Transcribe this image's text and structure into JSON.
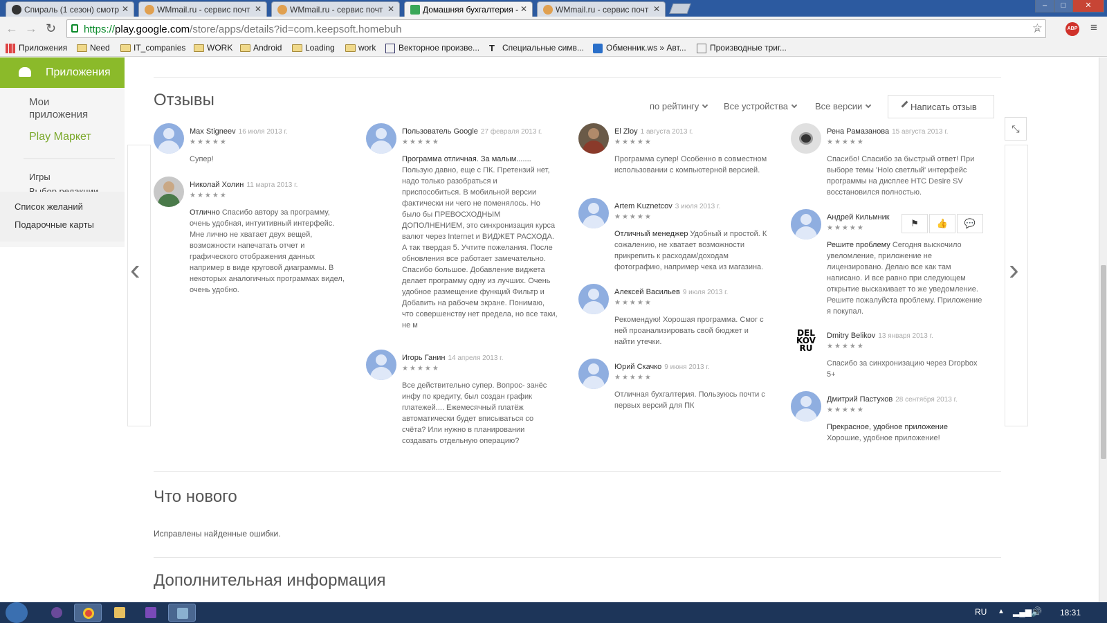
{
  "tabs": [
    {
      "label": "Спираль (1 сезон) смотр"
    },
    {
      "label": "WMmail.ru - сервис почт"
    },
    {
      "label": "WMmail.ru - сервис почт"
    },
    {
      "label": "Домашняя бухгалтерия -"
    },
    {
      "label": "WMmail.ru - сервис почт"
    }
  ],
  "window_controls": {
    "minimize": "–",
    "maximize": "□",
    "close": "✕"
  },
  "nav": {
    "back": "←",
    "forward": "→",
    "reload": "↻"
  },
  "url": {
    "scheme": "https://",
    "domain": "play.google.com",
    "path": "/store/apps/details?id=com.keepsoft.homebuh"
  },
  "abp": "ABP",
  "bookmarks": [
    {
      "label": "Приложения",
      "type": "apps"
    },
    {
      "label": "Need",
      "type": "folder"
    },
    {
      "label": "IT_companies",
      "type": "folder"
    },
    {
      "label": "WORK",
      "type": "folder"
    },
    {
      "label": "Android",
      "type": "folder"
    },
    {
      "label": "Loading",
      "type": "folder"
    },
    {
      "label": "work",
      "type": "folder"
    },
    {
      "label": "Векторное произве...",
      "type": "site"
    },
    {
      "label": "Специальные симв...",
      "type": "site"
    },
    {
      "label": "Обменник.ws » Авт...",
      "type": "site"
    },
    {
      "label": "Производные триг...",
      "type": "site"
    }
  ],
  "sidebar": {
    "header": "Приложения",
    "my_apps": "Мои приложения",
    "play_market": "Play Маркет",
    "games": "Игры",
    "editors_choice": "Выбор редакции",
    "wishlist": "Список желаний",
    "gift_cards": "Подарочные карты"
  },
  "reviews_section": {
    "title": "Отзывы",
    "filter_rating": "по рейтингу",
    "filter_devices": "Все устройства",
    "filter_versions": "Все версии",
    "write_review": "Написать отзыв",
    "prev": "‹",
    "next": "›",
    "collapse": "⤡"
  },
  "reviews": [
    {
      "name": "Max Stigneev",
      "date": "16 июля 2013 г.",
      "stars": "★★★★★",
      "title": "",
      "text": "Супер!"
    },
    {
      "name": "Николай Холин",
      "date": "11 марта 2013 г.",
      "stars": "★★★★★",
      "title": "Отлично",
      "text": "Спасибо автору за программу, очень удобная, интуитивный интерфейс. Мне лично не хватает двух вещей, возможности напечатать отчет и графического отображения данных например в виде круговой диаграммы. В некоторых аналогичных программах видел, очень удобно."
    },
    {
      "name": "Пользователь Google",
      "date": "27 февраля 2013 г.",
      "stars": "★★★★★",
      "title": "Программа отличная. За малым.......",
      "text": "Пользую давно, еще с ПК. Претензий нет, надо только разобраться и приспособиться. В мобильной версии фактически ни чего не поменялось. Но было бы ПРЕВОСХОДНЫМ ДОПОЛНЕНИЕМ, это синхронизация курса валют через Internet и ВИДЖЕТ РАСХОДА. А так твердая 5. Учтите пожелания. После обновления все работает замечательно. Спасибо большое. Добавление виджета делает программу одну из лучших. Очень удобное размещение функций Фильтр и Добавить на рабочем экране. Понимаю, что совершенству нет предела, но все таки, не м"
    },
    {
      "name": "Игорь Ганин",
      "date": "14 апреля 2013 г.",
      "stars": "★★★★★",
      "title": "",
      "text": "Все действительно супер. Вопрос- занёс инфу по кредиту, был создан график платежей.... Ежемесячный платёж автоматически будет вписываться со счёта? Или нужно в планировании создавать отдельную операцию?"
    },
    {
      "name": "El Zloy",
      "date": "1 августа 2013 г.",
      "stars": "★★★★★",
      "title": "",
      "text": "Программа супер! Особенно в совместном использовании с компьютерной версией."
    },
    {
      "name": "Artem Kuznetcov",
      "date": "3 июля 2013 г.",
      "stars": "★★★★★",
      "title": "Отличный менеджер",
      "text": "Удобный и простой. К сожалению, не хватает возможности прикрепить к расходам/доходам фотографию, например чека из магазина."
    },
    {
      "name": "Алексей Васильев",
      "date": "9 июля 2013 г.",
      "stars": "★★★★★",
      "title": "",
      "text": "Рекомендую! Хорошая программа. Смог с ней проанализировать свой бюджет и найти утечки."
    },
    {
      "name": "Юрий Скачко",
      "date": "9 июня 2013 г.",
      "stars": "★★★★★",
      "title": "",
      "text": "Отличная бухгалтерия. Пользуюсь почти с первых версий для ПК"
    },
    {
      "name": "Рена Рамазанова",
      "date": "15 августа 2013 г.",
      "stars": "★★★★★",
      "title": "",
      "text": "Спасибо! Спасибо за быстрый ответ! При выборе темы 'Holo светлый' интерфейс программы на дисплее HTC Desire SV восстановился полностью."
    },
    {
      "name": "Андрей Кильмник",
      "date": "",
      "stars": "★★★★★",
      "title": "Решите проблему",
      "text": "Сегодня выскочило увеломление, приложение не лицензировано. Делаю все как там написано. И все равно при следующем открытие выскакивает то же уведомление. Решите пожалуйста проблему. Приложение я покупал."
    },
    {
      "name": "Dmitry Belikov",
      "date": "13 января 2013 г.",
      "stars": "★★★★★",
      "title": "",
      "text": "Спасибо за синхронизацию через Dropbox 5+"
    },
    {
      "name": "Дмитрий Пастухов",
      "date": "28 сентября 2013 г.",
      "stars": "★★★★★",
      "title": "Прекрасное, удобное приложение",
      "text": "Хорошие, удобное приложение!"
    }
  ],
  "belikov_logo": "DEL KOV RU",
  "whats_new": {
    "title": "Что нового",
    "text": "Исправлены найденные ошибки."
  },
  "additional_info": {
    "title": "Дополнительная информация"
  },
  "taskbar": {
    "lang": "RU",
    "time": "18:31"
  }
}
